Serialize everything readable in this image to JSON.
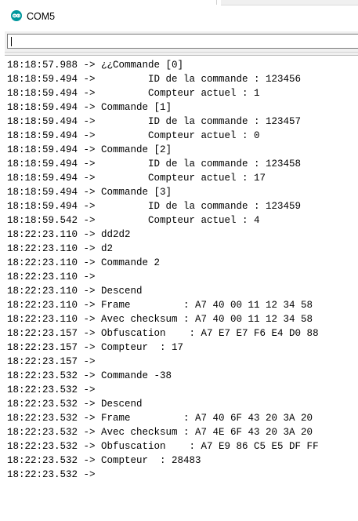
{
  "window": {
    "title": "COM5",
    "icon": "arduino-icon",
    "accent_color": "#00979d"
  },
  "send_bar": {
    "input_value": ""
  },
  "console": {
    "lines": [
      "18:18:57.988 -> ¿¿Commande [0]",
      "18:18:59.494 ->         ID de la commande : 123456",
      "18:18:59.494 ->         Compteur actuel : 1",
      "18:18:59.494 -> Commande [1]",
      "18:18:59.494 ->         ID de la commande : 123457",
      "18:18:59.494 ->         Compteur actuel : 0",
      "18:18:59.494 -> Commande [2]",
      "18:18:59.494 ->         ID de la commande : 123458",
      "18:18:59.494 ->         Compteur actuel : 17",
      "18:18:59.494 -> Commande [3]",
      "18:18:59.494 ->         ID de la commande : 123459",
      "18:18:59.542 ->         Compteur actuel : 4",
      "18:22:23.110 -> dd2d2",
      "18:22:23.110 -> d2",
      "18:22:23.110 -> Commande 2",
      "18:22:23.110 -> ",
      "18:22:23.110 -> Descend",
      "18:22:23.110 -> Frame         : A7 40 00 11 12 34 58",
      "18:22:23.110 -> Avec checksum : A7 40 00 11 12 34 58",
      "18:22:23.157 -> Obfuscation    : A7 E7 E7 F6 E4 D0 88",
      "18:22:23.157 -> Compteur  : 17",
      "18:22:23.157 -> ",
      "18:22:23.532 -> Commande -38",
      "18:22:23.532 -> ",
      "18:22:23.532 -> Descend",
      "18:22:23.532 -> Frame         : A7 40 6F 43 20 3A 20",
      "18:22:23.532 -> Avec checksum : A7 4E 6F 43 20 3A 20",
      "18:22:23.532 -> Obfuscation    : A7 E9 86 C5 E5 DF FF",
      "18:22:23.532 -> Compteur  : 28483",
      "18:22:23.532 -> "
    ]
  }
}
